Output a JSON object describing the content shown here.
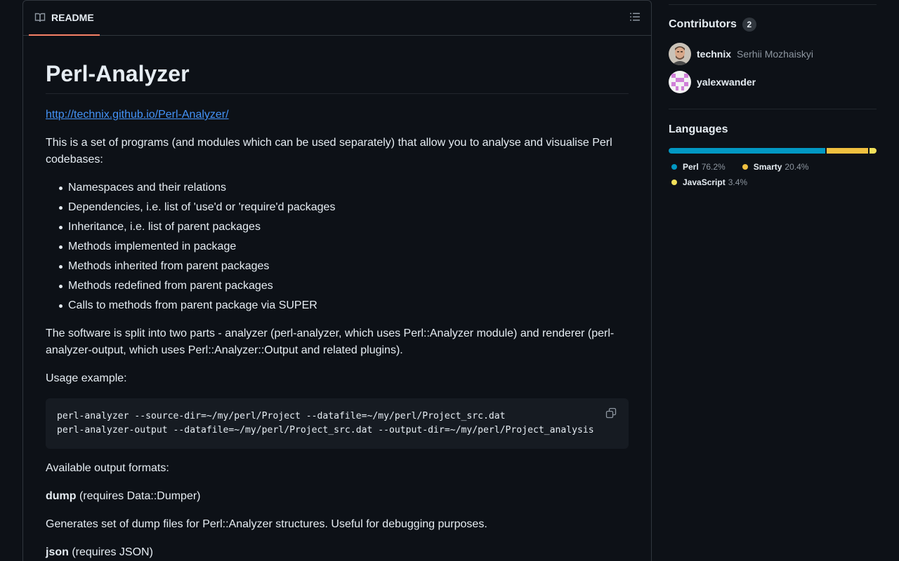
{
  "readme": {
    "tab_label": "README",
    "title": "Perl-Analyzer",
    "link": "http://technix.github.io/Perl-Analyzer/",
    "intro": "This is a set of programs (and modules which can be used separately) that allow you to analyse and visualise Perl codebases:",
    "features": [
      "Namespaces and their relations",
      "Dependencies, i.e. list of 'use'd or 'require'd packages",
      "Inheritance, i.e. list of parent packages",
      "Methods implemented in package",
      "Methods inherited from parent packages",
      "Methods redefined from parent packages",
      "Calls to methods from parent package via SUPER"
    ],
    "split_text": "The software is split into two parts - analyzer (perl-analyzer, which uses Perl::Analyzer module) and renderer (perl-analyzer-output, which uses Perl::Analyzer::Output and related plugins).",
    "usage_label": "Usage example:",
    "code_lines": [
      "perl-analyzer --source-dir=~/my/perl/Project --datafile=~/my/perl/Project_src.dat",
      "perl-analyzer-output --datafile=~/my/perl/Project_src.dat --output-dir=~/my/perl/Project_analysis"
    ],
    "formats_label": "Available output formats:",
    "dump_name": "dump",
    "dump_req": " (requires Data::Dumper)",
    "dump_desc": "Generates set of dump files for Perl::Analyzer structures. Useful for debugging purposes.",
    "json_name": "json",
    "json_req": " (requires JSON)"
  },
  "sidebar": {
    "contributors": {
      "title": "Contributors",
      "count": "2",
      "people": [
        {
          "login": "technix",
          "name": "Serhii Mozhaiskyi"
        },
        {
          "login": "yalexwander",
          "name": ""
        }
      ]
    },
    "languages": {
      "title": "Languages",
      "items": [
        {
          "name": "Perl",
          "percent": "76.2%",
          "value": 76.2,
          "color": "#0298c3"
        },
        {
          "name": "Smarty",
          "percent": "20.4%",
          "value": 20.4,
          "color": "#f0c040"
        },
        {
          "name": "JavaScript",
          "percent": "3.4%",
          "value": 3.4,
          "color": "#f1e05a"
        }
      ]
    }
  },
  "colors": {
    "background": "#0d1117",
    "border": "#30363d",
    "link": "#4493f8",
    "tab_underline": "#f78166",
    "muted_text": "#8d96a0"
  },
  "icons": {
    "readme_tab": "book-icon",
    "outline": "list-unordered-icon",
    "copy": "copy-icon"
  }
}
